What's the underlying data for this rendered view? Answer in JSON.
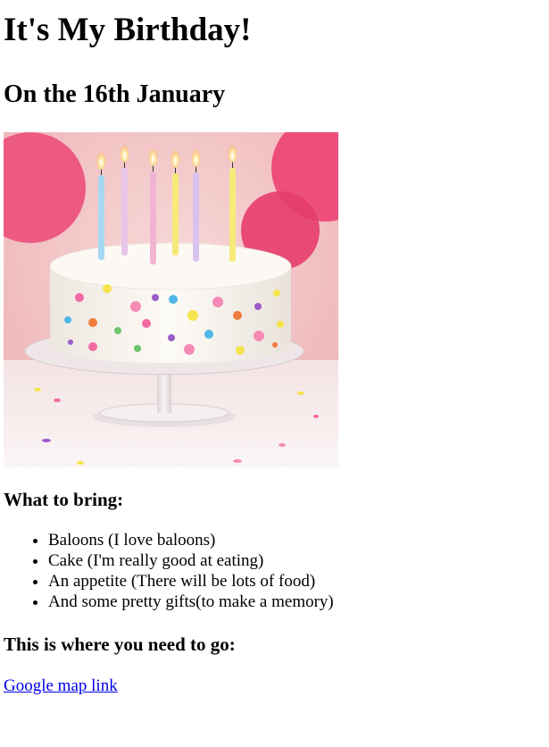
{
  "page": {
    "title": "It's My Birthday!",
    "subtitle": "On the 16th January"
  },
  "image": {
    "alt": "Birthday cake with candles",
    "colors": {
      "background": "#f4c6c9",
      "table": "#f7eff0",
      "frosting": "#fbf8f3",
      "balloon": "#ec4f7c",
      "glass": "#e9e2e4"
    }
  },
  "bring": {
    "heading": "What to bring:",
    "items": [
      "Baloons (I love baloons)",
      "Cake (I'm really good at eating)",
      "An appetite (There will be lots of food)",
      "And some pretty gifts(to make a memory)"
    ]
  },
  "directions": {
    "heading": "This is where you need to go:",
    "link_text": "Google map link",
    "link_color": "#0000ee"
  }
}
